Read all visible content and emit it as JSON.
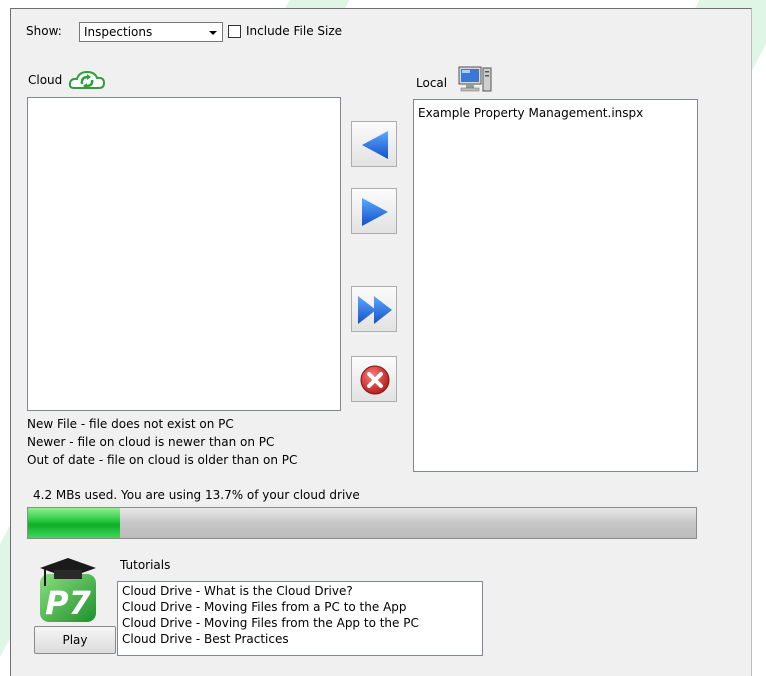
{
  "toolbar": {
    "show_label": "Show:",
    "show_value": "Inspections",
    "include_file_size_label": "Include File Size",
    "include_file_size_checked": false
  },
  "cloud": {
    "label": "Cloud",
    "icon": "cloud-sync-icon",
    "files": []
  },
  "local": {
    "label": "Local",
    "icon": "computer-icon",
    "files": [
      "Example Property Management.inspx"
    ]
  },
  "transfer_buttons": [
    {
      "name": "copy-to-cloud-button",
      "icon": "arrow-left-icon"
    },
    {
      "name": "copy-to-local-button",
      "icon": "arrow-right-icon"
    },
    {
      "name": "copy-all-button",
      "icon": "double-arrow-right-icon"
    },
    {
      "name": "delete-button",
      "icon": "red-x-icon"
    }
  ],
  "legend": [
    "New File - file does not exist on PC",
    "Newer - file on cloud is newer than on PC",
    "Out of date - file on cloud is older than on PC"
  ],
  "usage": {
    "text": "4.2 MBs used. You are using 13.7% of your cloud drive",
    "percent": 13.7
  },
  "tutorials": {
    "label": "Tutorials",
    "logo_text": "P7",
    "items": [
      "Cloud Drive - What is the Cloud Drive?",
      "Cloud Drive - Moving Files from a PC to the App",
      "Cloud Drive - Moving Files from the App to the PC",
      "Cloud Drive - Best Practices"
    ],
    "play_label": "Play"
  },
  "colors": {
    "progress_green": "#1fc23a",
    "arrow_blue": "#1f6fe0",
    "delete_red": "#d42a2a",
    "logo_green": "#3cb44a"
  }
}
